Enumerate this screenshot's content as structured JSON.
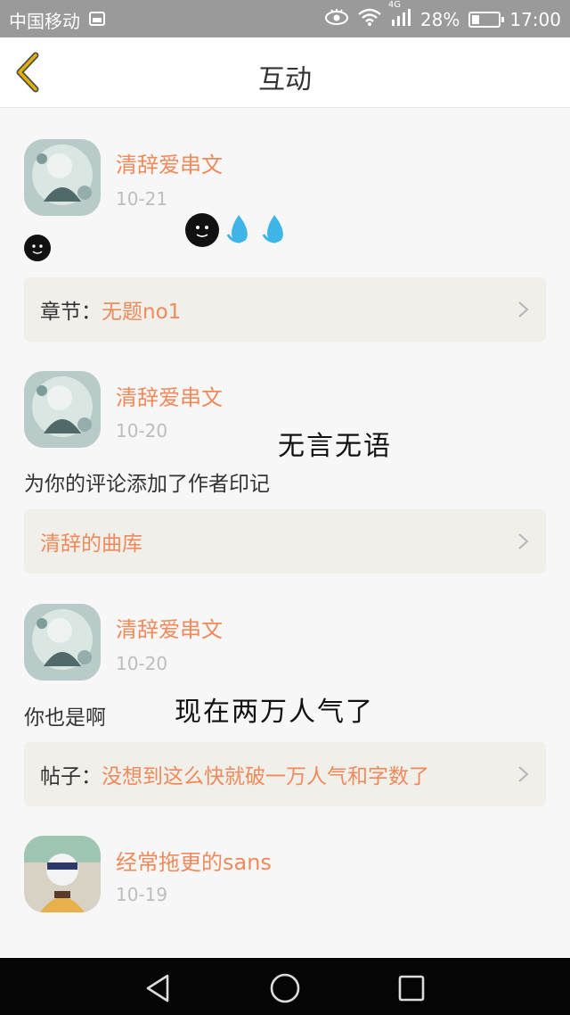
{
  "status_bar": {
    "carrier": "中国移动",
    "network": "4G",
    "battery_percent": "28%",
    "time": "17:00",
    "battery_level": 0.28
  },
  "header": {
    "title": "互动",
    "back_icon": "chevron-left-icon"
  },
  "items": [
    {
      "user": "清辞爱串文",
      "date": "10-21",
      "link_prefix": "章节：",
      "link_text": "无题no1"
    },
    {
      "user": "清辞爱串文",
      "date": "10-20",
      "content": "为你的评论添加了作者印记",
      "link_text": "清辞的曲库",
      "annotation": "无言无语"
    },
    {
      "user": "清辞爱串文",
      "date": "10-20",
      "content": "你也是啊",
      "link_prefix": "帖子：",
      "link_text": "没想到这么快就破一万人气和字数了",
      "annotation": "现在两万人气了"
    },
    {
      "user": "经常拖更的sans",
      "date": "10-19"
    }
  ],
  "colors": {
    "accent": "#f08a5b",
    "link_bg": "#f1efea",
    "back_icon": "#e0b100"
  }
}
